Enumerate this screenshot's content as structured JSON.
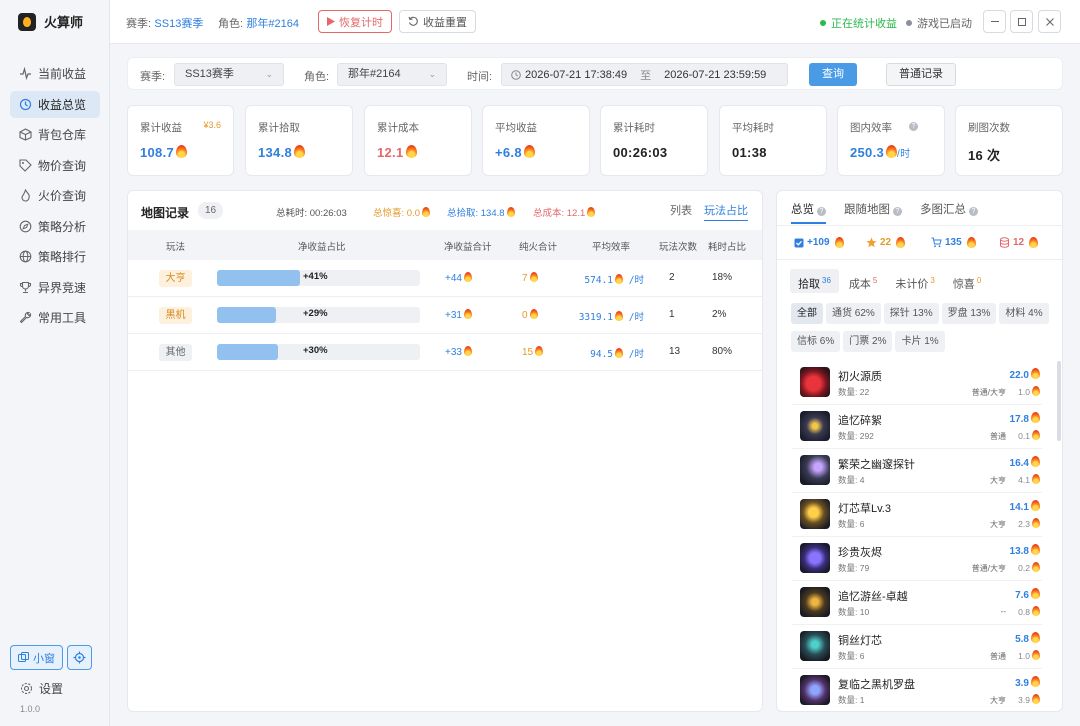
{
  "app": {
    "name": "火算师",
    "version": "1.0.0"
  },
  "sidebar": {
    "items": [
      {
        "label": "当前收益",
        "icon": "pulse-icon"
      },
      {
        "label": "收益总览",
        "icon": "history-icon",
        "active": true
      },
      {
        "label": "背包仓库",
        "icon": "box-icon"
      },
      {
        "label": "物价查询",
        "icon": "tag-icon"
      },
      {
        "label": "火价查询",
        "icon": "flame-icon"
      },
      {
        "label": "策略分析",
        "icon": "compass-icon"
      },
      {
        "label": "策略排行",
        "icon": "globe-icon"
      },
      {
        "label": "异界竞速",
        "icon": "trophy-icon"
      },
      {
        "label": "常用工具",
        "icon": "wrench-icon"
      }
    ],
    "mini_window": "小窗",
    "settings": "设置"
  },
  "header": {
    "season_label": "赛季:",
    "season_value": "SS13赛季",
    "role_label": "角色:",
    "role_value": "那年#2164",
    "resume_button": "恢复计时",
    "reset_button": "收益重置",
    "status_counting": "正在统计收益",
    "status_game": "游戏已启动",
    "status_counting_color": "#2db84d",
    "status_game_color": "#8a8f99"
  },
  "filter": {
    "season_label": "赛季:",
    "season_value": "SS13赛季",
    "role_label": "角色:",
    "role_value": "那年#2164",
    "time_label": "时间:",
    "time_start": "2026-07-21 17:38:49",
    "time_sep": "至",
    "time_end": "2026-07-21 23:59:59",
    "query_button": "查询",
    "record_button": "普通记录"
  },
  "stats": [
    {
      "title": "累计收益",
      "value": "108.7",
      "extra": "¥3.6",
      "color": "#2f7fe0",
      "fire": true
    },
    {
      "title": "累计拾取",
      "value": "134.8",
      "color": "#2f7fe0",
      "fire": true
    },
    {
      "title": "累计成本",
      "value": "12.1",
      "color": "#e4686b",
      "fire": true
    },
    {
      "title": "平均收益",
      "value": "+6.8",
      "color": "#2f7fe0",
      "fire": true
    },
    {
      "title": "累计耗时",
      "value": "00:26:03",
      "color": "#222"
    },
    {
      "title": "平均耗时",
      "value": "01:38",
      "color": "#222"
    },
    {
      "title": "图内效率",
      "value": "250.3",
      "suffix": "/时",
      "color": "#2f7fe0",
      "fire": true,
      "help": true
    },
    {
      "title": "刷图次数",
      "value": "16 次",
      "color": "#222"
    }
  ],
  "map_panel": {
    "title": "地图记录",
    "count": "16",
    "total_time": "总耗时: 00:26:03",
    "surprise": "总惊喜: 0.0",
    "pickup": "总拾取: 134.8",
    "cost": "总成本: 12.1",
    "tabs": [
      "列表",
      "玩法占比"
    ],
    "active_tab": "玩法占比",
    "columns": [
      "玩法",
      "净收益占比",
      "净收益合计",
      "纯火合计",
      "平均效率",
      "玩法次数",
      "耗时占比"
    ],
    "rows": [
      {
        "mode": "大亨",
        "ratio": 0.41,
        "ratio_text": "+41%",
        "net": "+44",
        "pure": "7",
        "eff": "574.1",
        "unit": "/时",
        "times": "2",
        "time_ratio": "18%",
        "tag_bg": "#fdf0dc",
        "tag_fg": "#d68a1e"
      },
      {
        "mode": "黑机",
        "ratio": 0.29,
        "ratio_text": "+29%",
        "net": "+31",
        "pure": "0",
        "eff": "3319.1",
        "unit": "/时",
        "times": "1",
        "time_ratio": "2%",
        "tag_bg": "#fdf0dc",
        "tag_fg": "#d68a1e"
      },
      {
        "mode": "其他",
        "ratio": 0.3,
        "ratio_text": "+30%",
        "net": "+33",
        "pure": "15",
        "eff": "94.5",
        "unit": "/时",
        "times": "13",
        "time_ratio": "80%",
        "tag_bg": "#eef0f4",
        "tag_fg": "#666"
      }
    ]
  },
  "right_panel": {
    "tabs": [
      "总览",
      "跟随地图",
      "多图汇总"
    ],
    "summary": [
      {
        "value": "+109",
        "color": "#2f7fe0",
        "icon": "checkbox-icon"
      },
      {
        "value": "22",
        "color": "#e69a2b",
        "icon": "star-icon"
      },
      {
        "value": "135",
        "color": "#2f7fe0",
        "icon": "cart-icon"
      },
      {
        "value": "12",
        "color": "#e4686b",
        "icon": "coins-icon"
      }
    ],
    "sub_tabs": [
      {
        "label": "拾取",
        "count": "36",
        "count_color": "#2f7fe0"
      },
      {
        "label": "成本",
        "count": "5",
        "count_color": "#e4686b"
      },
      {
        "label": "未计价",
        "count": "3",
        "count_color": "#e69a2b"
      },
      {
        "label": "惊喜",
        "count": "0",
        "count_color": "#e69a2b"
      }
    ],
    "chips": [
      "全部",
      "通货 62%",
      "探针 13%",
      "罗盘 13%",
      "材料 4%",
      "信标 6%",
      "门票 2%",
      "卡片 1%"
    ],
    "items": [
      {
        "name": "初火源质",
        "qty": "数量: 22",
        "src": "普通/大亨",
        "value": "22.0",
        "unit": "1.0"
      },
      {
        "name": "追忆碎絮",
        "qty": "数量: 292",
        "src": "普通",
        "value": "17.8",
        "unit": "0.1"
      },
      {
        "name": "繁荣之幽邃探针",
        "qty": "数量: 4",
        "src": "大亨",
        "value": "16.4",
        "unit": "4.1"
      },
      {
        "name": "灯芯草Lv.3",
        "qty": "数量: 6",
        "src": "大亨",
        "value": "14.1",
        "unit": "2.3"
      },
      {
        "name": "珍贵灰烬",
        "qty": "数量: 79",
        "src": "普通/大亨",
        "value": "13.8",
        "unit": "0.2"
      },
      {
        "name": "追忆游丝-卓越",
        "qty": "数量: 10",
        "src": "--",
        "value": "7.6",
        "unit": "0.8"
      },
      {
        "name": "铜丝灯芯",
        "qty": "数量: 6",
        "src": "普通",
        "value": "5.8",
        "unit": "1.0"
      },
      {
        "name": "复临之黑机罗盘",
        "qty": "数量: 1",
        "src": "大亨",
        "value": "3.9",
        "unit": "3.9"
      }
    ]
  }
}
